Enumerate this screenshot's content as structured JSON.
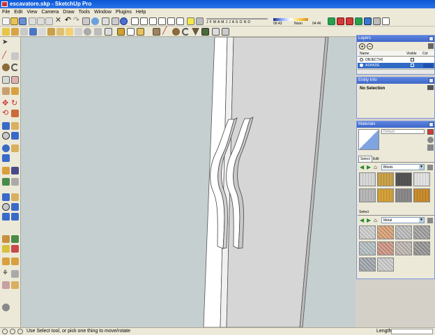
{
  "window": {
    "title": "escavatore.skp - SketchUp Pro"
  },
  "menu": [
    "File",
    "Edit",
    "View",
    "Camera",
    "Draw",
    "Tools",
    "Window",
    "Plugins",
    "Help"
  ],
  "shadow_bar": {
    "months": "J F M A M J J A S O N D",
    "time_start": "06:43",
    "noon": "Noon",
    "time_end": "04:46"
  },
  "layers": {
    "title": "Layers",
    "columns": {
      "name": "Name",
      "visible": "Visible",
      "color": "Col"
    },
    "rows": [
      {
        "name": "OBJECT#0",
        "selected": false
      },
      {
        "name": "ASHADE",
        "selected": true
      }
    ]
  },
  "entity_info": {
    "title": "Entity Info",
    "status": "No Selection"
  },
  "materials": {
    "title": "Materials",
    "default_label": "Default",
    "tabs": [
      "Select",
      "Edit"
    ],
    "library_1": "Blinds",
    "library_2": "Metal",
    "section_label": "Select",
    "blinds_colors": [
      "#d8d8d8",
      "#c9a24a",
      "#555555",
      "#e2e2e2",
      "#b8b8b8",
      "#d4a23a",
      "#8a8a8a",
      "#c98c2e"
    ],
    "metal_colors": [
      "#c9c9c9",
      "#d49a6e",
      "#b5b5b5",
      "#9a9a9a",
      "#aeb8be",
      "#c98d7a",
      "#b9b0a9",
      "#8e8e8e",
      "#9aa0a8",
      "#c7c7c7"
    ]
  },
  "status": {
    "hint": "Use Select tool, or pick one thing to move/rotate",
    "measure_label": "Length",
    "measure_value": ""
  }
}
